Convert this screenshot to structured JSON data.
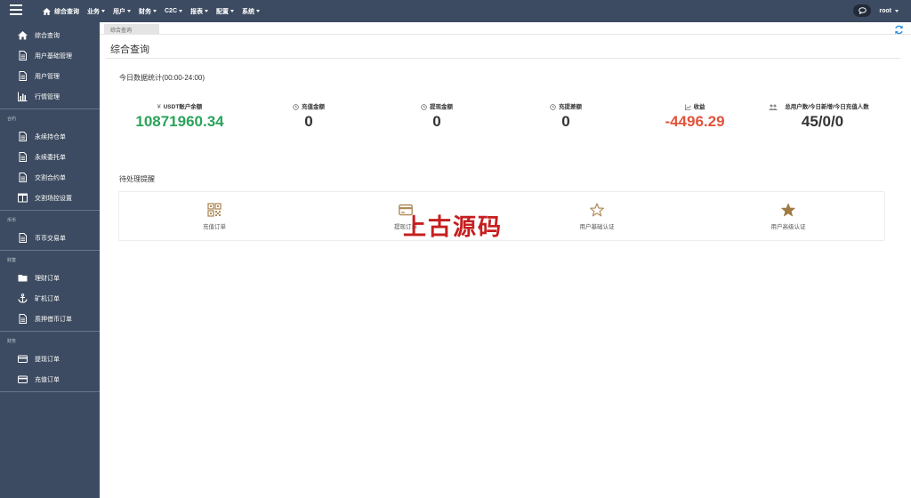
{
  "topnav": {
    "items": [
      {
        "label": "综合查询",
        "icon": "home-icon"
      },
      {
        "label": "业务"
      },
      {
        "label": "用户"
      },
      {
        "label": "财务"
      },
      {
        "label": "C2C"
      },
      {
        "label": "报表"
      },
      {
        "label": "配置"
      },
      {
        "label": "系统"
      }
    ],
    "username": "root"
  },
  "sidebar": {
    "items": [
      {
        "label": "综合查询",
        "icon": "home-icon"
      },
      {
        "label": "用户基础管理",
        "icon": "document-icon"
      },
      {
        "label": "用户管理",
        "icon": "document-icon"
      },
      {
        "label": "行情管理",
        "icon": "bar-chart-icon"
      }
    ],
    "groups": [
      {
        "title": "合约",
        "items": [
          {
            "label": "永续持仓单",
            "icon": "document-icon"
          },
          {
            "label": "永续委托单",
            "icon": "document-icon"
          },
          {
            "label": "交割合约单",
            "icon": "document-icon"
          },
          {
            "label": "交割场控设置",
            "icon": "columns-icon"
          }
        ]
      },
      {
        "title": "币币",
        "items": [
          {
            "label": "币币交易单",
            "icon": "document-icon"
          }
        ]
      },
      {
        "title": "财富",
        "items": [
          {
            "label": "理财订单",
            "icon": "folder-icon"
          },
          {
            "label": "矿机订单",
            "icon": "anchor-icon"
          },
          {
            "label": "质押借币订单",
            "icon": "document-icon"
          }
        ]
      },
      {
        "title": "财务",
        "items": [
          {
            "label": "提现订单",
            "icon": "card-icon"
          },
          {
            "label": "充值订单",
            "icon": "card-icon"
          }
        ]
      }
    ]
  },
  "tab": {
    "label": "综合查询"
  },
  "page": {
    "title": "综合查询"
  },
  "stats": {
    "title": "今日数据统计(00:00-24:00)",
    "items": [
      {
        "label": "USDT账户余额",
        "value": "10871960.34",
        "icon": "yen-icon",
        "color": "#2aa35a"
      },
      {
        "label": "充值金额",
        "value": "0",
        "icon": "clock-icon"
      },
      {
        "label": "提现金额",
        "value": "0",
        "icon": "clock-icon"
      },
      {
        "label": "充提差额",
        "value": "0",
        "icon": "clock-icon"
      },
      {
        "label": "收益",
        "value": "-4496.29",
        "icon": "line-chart-icon",
        "color": "#e0543a"
      },
      {
        "label": "总用户数/今日新增/今日充值人数",
        "value": "45/0/0",
        "icon": "users-icon"
      }
    ]
  },
  "pending": {
    "title": "待处理提醒",
    "items": [
      {
        "label": "充值订单",
        "icon": "qrcode-icon"
      },
      {
        "label": "提现订单",
        "icon": "card-icon"
      },
      {
        "label": "用户基础认证",
        "icon": "star-outline-icon"
      },
      {
        "label": "用户高级认证",
        "icon": "star-filled-icon"
      }
    ],
    "accent_color": "#b08a5a"
  },
  "watermark": "上古源码"
}
